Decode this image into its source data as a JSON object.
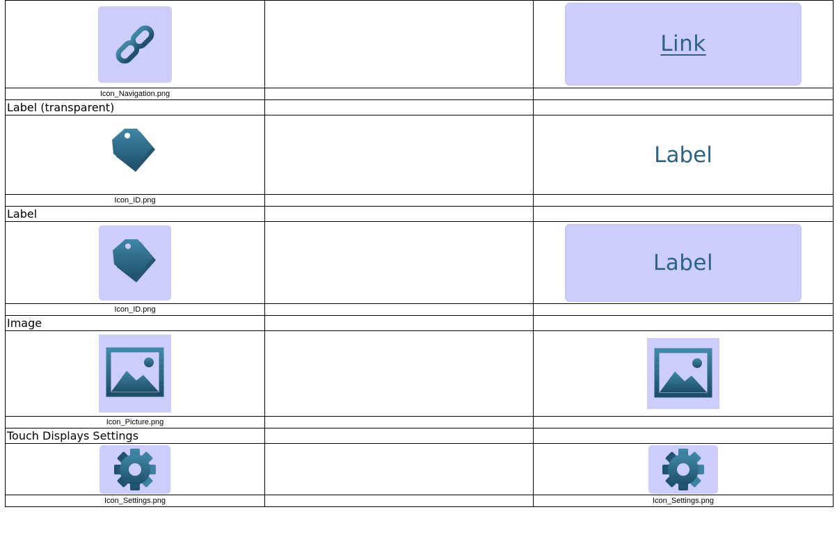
{
  "rows": [
    {
      "preview_text": "Link",
      "caption_left": "Icon_Navigation.png",
      "caption_right": "",
      "icon": "chain-link-icon"
    },
    {
      "header": "Label (transparent)",
      "preview_text": "Label",
      "caption_left": "Icon_ID.png",
      "caption_right": "",
      "icon": "tag-icon"
    },
    {
      "header": "Label",
      "preview_text": "Label",
      "caption_left": "Icon_ID.png",
      "caption_right": "",
      "icon": "tag-icon"
    },
    {
      "header": "Image",
      "caption_left": "Icon_Picture.png",
      "caption_right": "",
      "icon": "picture-icon"
    },
    {
      "header": "Touch Displays Settings",
      "caption_left": "Icon_Settings.png",
      "caption_right": "Icon_Settings.png",
      "icon": "gear-icon"
    }
  ],
  "colors": {
    "tile_background": "#cdcdfb",
    "icon_teal": "#2c6383",
    "text_teal": "#2c6383"
  }
}
